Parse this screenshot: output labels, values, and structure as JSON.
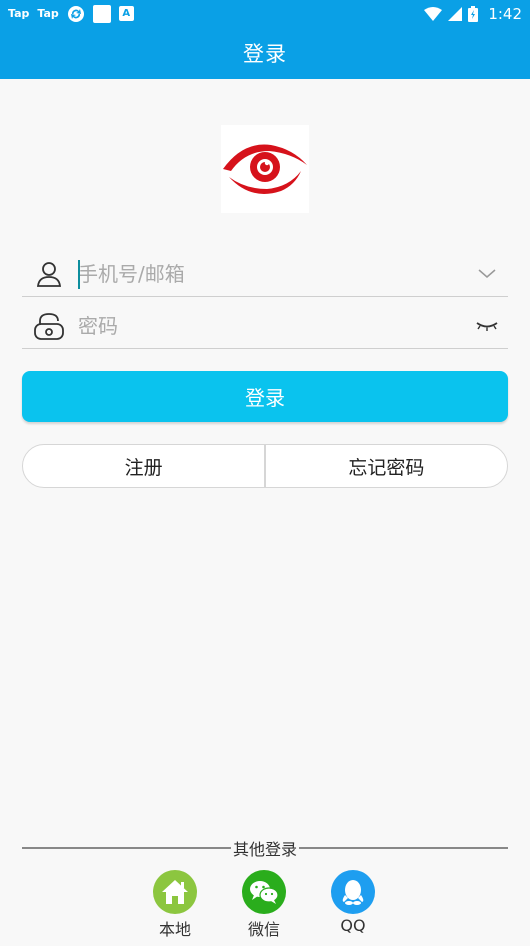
{
  "status_bar": {
    "left_labels": [
      "Tap",
      "Tap"
    ],
    "time": "1:42"
  },
  "header": {
    "title": "登录"
  },
  "form": {
    "account": {
      "placeholder": "手机号/邮箱",
      "value": ""
    },
    "password": {
      "placeholder": "密码",
      "value": ""
    },
    "login_label": "登录"
  },
  "secondary": {
    "register_label": "注册",
    "forgot_label": "忘记密码"
  },
  "other_login": {
    "title": "其他登录",
    "options": [
      {
        "label": "本地",
        "icon": "home-icon",
        "color": "#8cc63f"
      },
      {
        "label": "微信",
        "icon": "wechat-icon",
        "color": "#2aad1c"
      },
      {
        "label": "QQ",
        "icon": "qq-icon",
        "color": "#1e9ef0"
      }
    ]
  },
  "colors": {
    "primary": "#0aa0e6",
    "button": "#0ac3ee",
    "logo_red": "#d6121b"
  }
}
